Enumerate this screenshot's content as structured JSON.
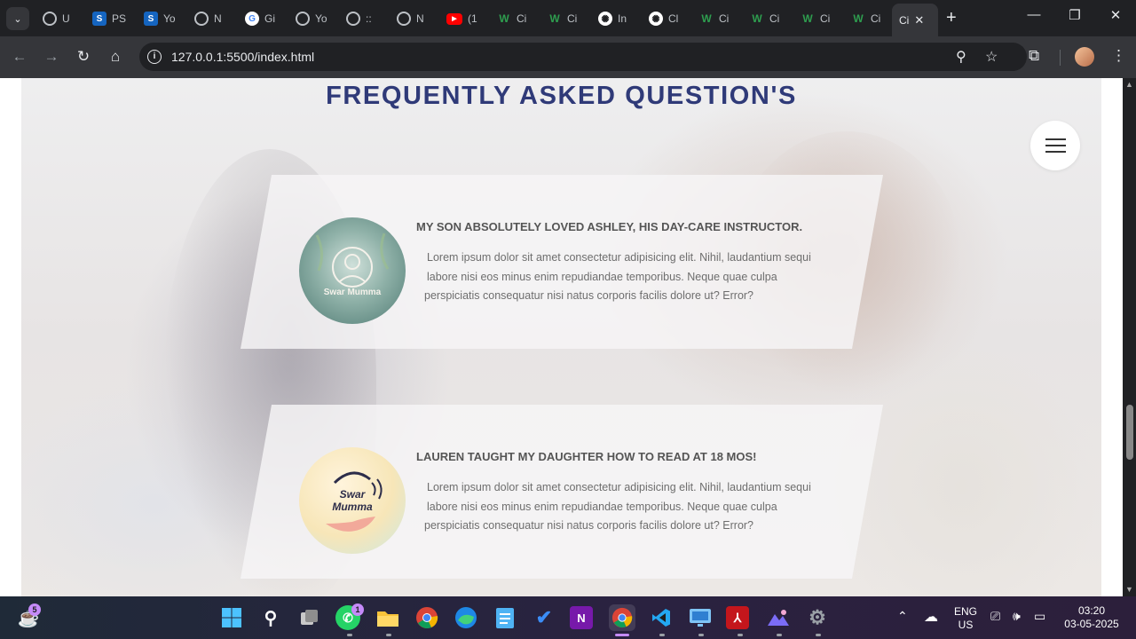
{
  "browser": {
    "tabs": [
      {
        "label": "U",
        "icon": "globe-icon"
      },
      {
        "label": "PS",
        "icon": "s-logo-icon"
      },
      {
        "label": "Yo",
        "icon": "s-logo-icon"
      },
      {
        "label": "N",
        "icon": "chrome-icon"
      },
      {
        "label": "Gi",
        "icon": "google-icon"
      },
      {
        "label": "Yo",
        "icon": "globe-icon"
      },
      {
        "label": "::",
        "icon": "globe-icon"
      },
      {
        "label": "N",
        "icon": "chrome-icon"
      },
      {
        "label": "(1",
        "icon": "youtube-icon"
      },
      {
        "label": "Ci",
        "icon": "wix-icon"
      },
      {
        "label": "Ci",
        "icon": "wix-icon"
      },
      {
        "label": "In",
        "icon": "openai-icon"
      },
      {
        "label": "Cl",
        "icon": "openai-icon"
      },
      {
        "label": "Ci",
        "icon": "wix-icon"
      },
      {
        "label": "Ci",
        "icon": "wix-icon"
      },
      {
        "label": "Ci",
        "icon": "wix-icon"
      },
      {
        "label": "Ci",
        "icon": "wix-icon"
      }
    ],
    "active_tab": {
      "label": "Ci"
    },
    "url": "127.0.0.1:5500/index.html"
  },
  "page": {
    "title": "FREQUENTLY ASKED QUESTION'S",
    "cards": [
      {
        "question": "MY SON ABSOLUTELY LOVED ASHLEY, HIS DAY-CARE INSTRUCTOR.",
        "answer_lines": [
          "Lorem ipsum dolor sit amet consectetur adipisicing elit. Nihil, laudantium sequi",
          "labore nisi eos minus enim repudiandae temporibus. Neque quae culpa",
          "perspiciatis consequatur nisi natus corporis facilis dolore ut? Error?"
        ],
        "avatar_text": "Swar Mumma"
      },
      {
        "question": "LAUREN TAUGHT MY DAUGHTER HOW TO READ AT 18 MOS!",
        "answer_lines": [
          "Lorem ipsum dolor sit amet consectetur adipisicing elit. Nihil, laudantium sequi",
          "labore nisi eos minus enim repudiandae temporibus. Neque quae culpa",
          "perspiciatis consequatur nisi natus corporis facilis dolore ut? Error?"
        ],
        "avatar_text": "Swar Mumma"
      }
    ]
  },
  "taskbar": {
    "notification_badge": "5",
    "whatsapp_badge": "1",
    "language_line1": "ENG",
    "language_line2": "US",
    "time": "03:20",
    "date": "03-05-2025"
  },
  "colors": {
    "title": "#2f3a78",
    "accent": "#c58af9"
  }
}
